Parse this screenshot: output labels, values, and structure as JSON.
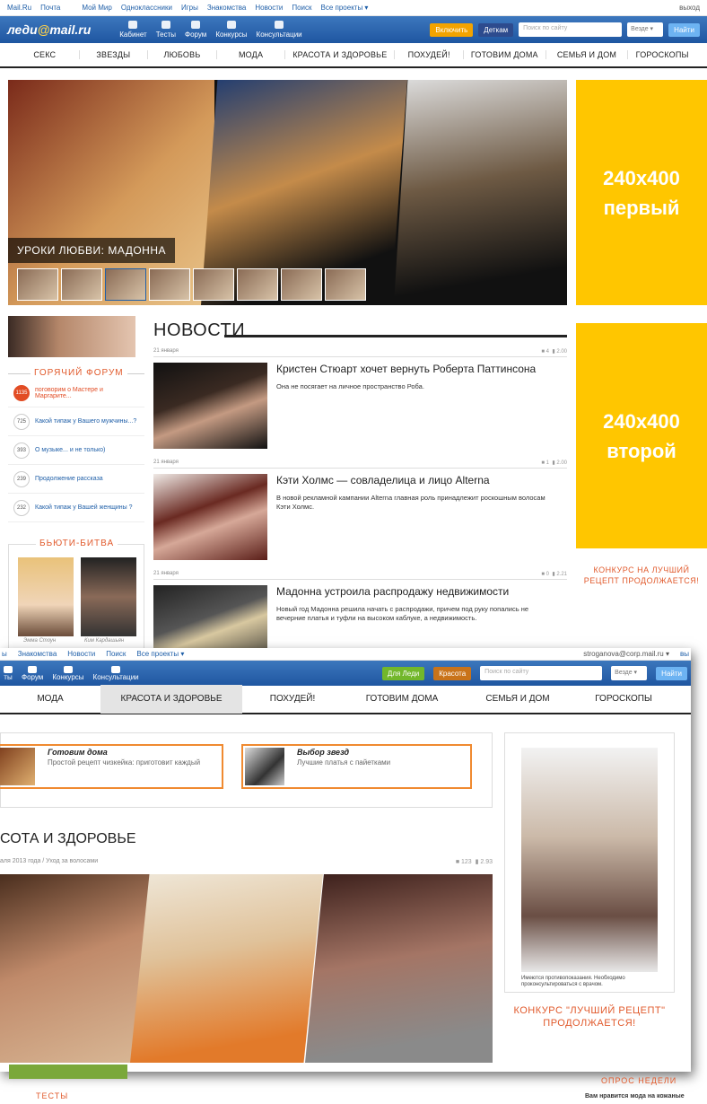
{
  "topbar": {
    "links": [
      "Mail.Ru",
      "Почта",
      "Мой Мир",
      "Одноклассники",
      "Игры",
      "Знакомства",
      "Новости",
      "Поиск",
      "Все проекты ▾"
    ],
    "right": "выход"
  },
  "header": {
    "logo_prefix": "леди",
    "logo_at": "@",
    "logo_suffix": "mail.ru",
    "nav": [
      "Кабинет",
      "Тесты",
      "Форум",
      "Конкурсы",
      "Консультации"
    ],
    "btn_enable": "Включить",
    "btn_kids": "Деткам",
    "search_placeholder": "Поиск по сайту",
    "search_scope": "Везде ▾",
    "search_button": "Найти"
  },
  "categories": [
    "СЕКС",
    "ЗВЕЗДЫ",
    "ЛЮБОВЬ",
    "МОДА",
    "КРАСОТА И ЗДОРОВЬЕ",
    "ПОХУДЕЙ!",
    "ГОТОВИМ ДОМА",
    "СЕМЬЯ И ДОМ",
    "ГОРОСКОПЫ"
  ],
  "hero": {
    "title": "УРОКИ ЛЮБВИ: МАДОННА"
  },
  "ads": {
    "first_size": "240x400",
    "first_label": "первый",
    "second_size": "240x400",
    "second_label": "второй"
  },
  "forum": {
    "heading": "ГОРЯЧИЙ ФОРУМ",
    "items": [
      {
        "count": "1135",
        "text": "поговорим о Мастере и Маргарите..."
      },
      {
        "count": "725",
        "text": "Какой типаж у Вашего мужчины...?"
      },
      {
        "count": "393",
        "text": "О музыке... и не только)"
      },
      {
        "count": "239",
        "text": "Продолжение рассказа"
      },
      {
        "count": "232",
        "text": "Какой типаж у Вашей женщины ?"
      }
    ]
  },
  "beauty_battle": {
    "heading": "БЬЮТИ-БИТВА",
    "left_name": "Эмма Стоун",
    "right_name": "Ким Кардашьян"
  },
  "news": {
    "heading": "НОВОСТИ",
    "items": [
      {
        "date": "21 января",
        "comments": "4",
        "rating": "2.00",
        "title": "Кристен Стюарт хочет вернуть Роберта Паттинсона",
        "text": "Она не посягает на личное пространство Роба."
      },
      {
        "date": "21 января",
        "comments": "1",
        "rating": "2.00",
        "title": "Кэти Холмс — совладелица и лицо Alterna",
        "text": "В новой рекламной кампании Alterna главная роль принадлежит роскошным волосам Кэти Холмс."
      },
      {
        "date": "21 января",
        "comments": "0",
        "rating": "2.21",
        "title": "Мадонна устроила распродажу недвижимости",
        "text": "Новый год Мадонна решила начать с распродажи, причем под руку попались не вечерние платья и туфли на высоком каблуке, а недвижимость."
      }
    ]
  },
  "contest": {
    "text": "КОНКУРС НА ЛУЧШИЙ РЕЦЕПТ ПРОДОЛЖАЕТСЯ!"
  },
  "overlay": {
    "top_links": [
      "ы",
      "Знакомства",
      "Новости",
      "Поиск",
      "Все проекты ▾"
    ],
    "user": "stroganova@corp.mail.ru ▾",
    "user_right": "вы",
    "nav": [
      "ты",
      "Форум",
      "Конкурсы",
      "Консультации"
    ],
    "btn_ladies": "Для Леди",
    "btn_beauty": "Красота",
    "search_placeholder": "Поиск по сайту",
    "search_scope": "Везде ▾",
    "search_button": "Найти",
    "categories": [
      "МОДА",
      "КРАСОТА И ЗДОРОВЬЕ",
      "ПОХУДЕЙ!",
      "ГОТОВИМ ДОМА",
      "СЕМЬЯ И ДОМ",
      "ГОРОСКОПЫ"
    ],
    "promo1_title": "Готовим дома",
    "promo1_text": "Простой рецепт чизкейка: приготовит каждый",
    "promo2_title": "Выбор звезд",
    "promo2_text": "Лучшие платья с пайетками",
    "section_title": "СОТА И ЗДОРОВЬЕ",
    "meta_left": "аля 2013 года / Уход за волосами",
    "meta_comments": "123",
    "meta_rating": "2.93",
    "ad_note": "Имеются противопоказания. Необходимо проконсультироваться с врачом.",
    "contest": "КОНКУРС \"ЛУЧШИЙ РЕЦЕПТ\" ПРОДОЛЖАЕТСЯ!"
  },
  "bottom": {
    "tests": "ТЕСТЫ",
    "poll_heading": "ОПРОС НЕДЕЛИ",
    "poll_question": "Вам нравится мода на кожаные"
  }
}
